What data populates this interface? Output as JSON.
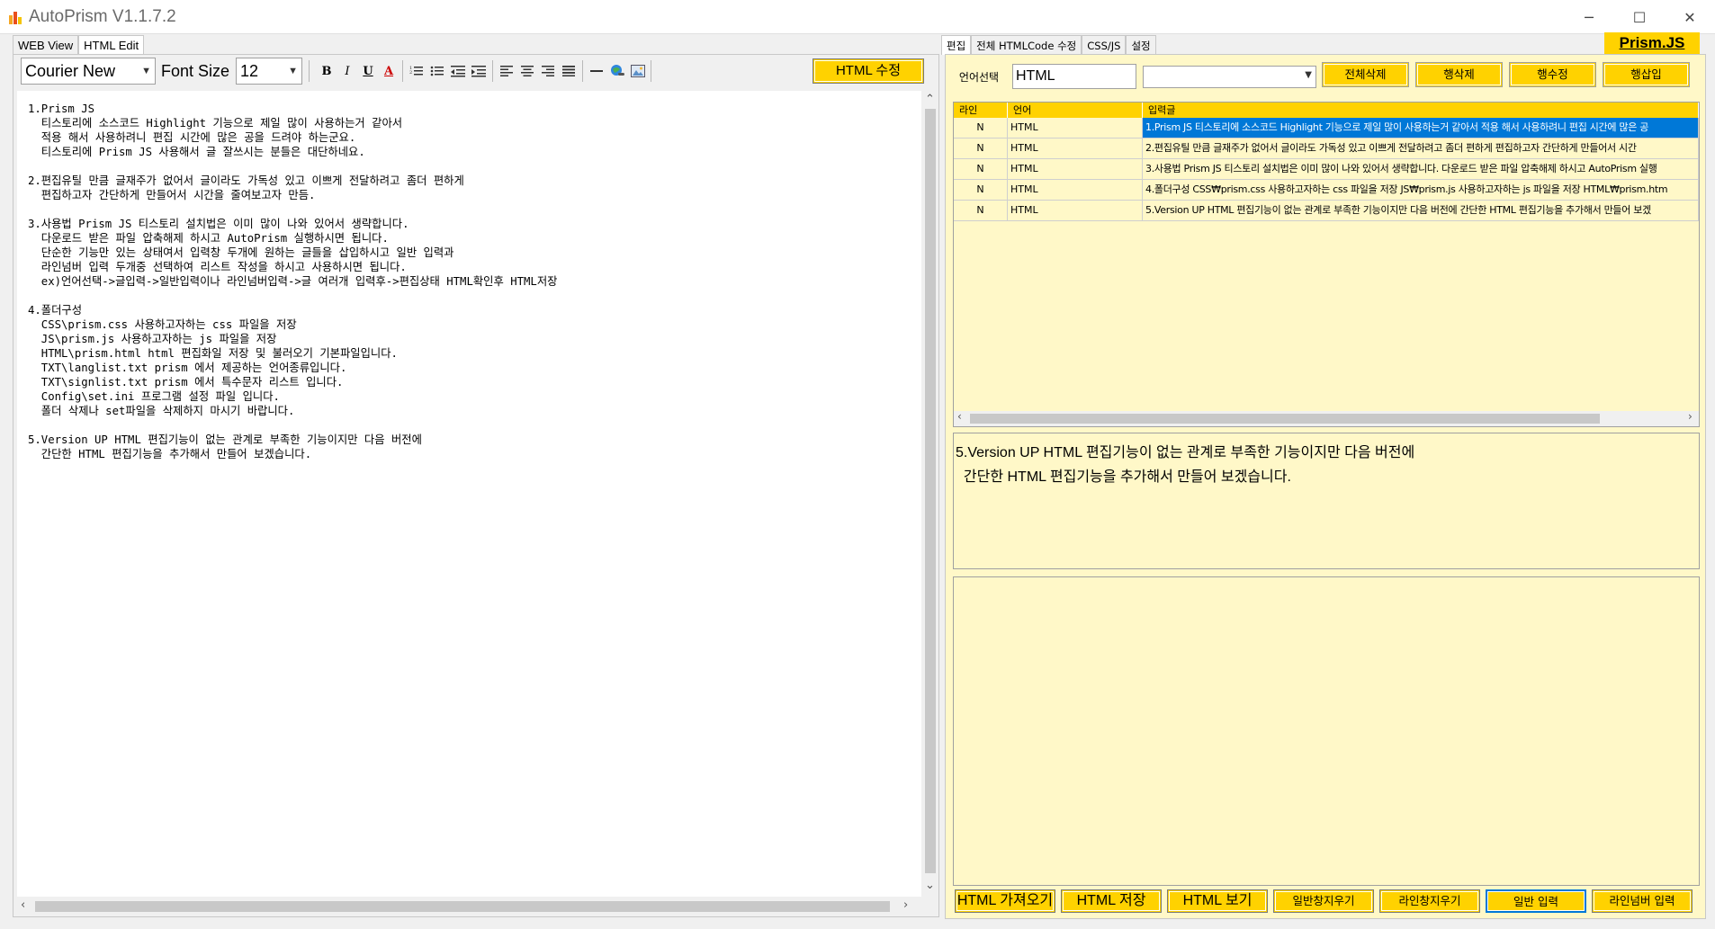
{
  "window": {
    "title": "AutoPrism V1.1.7.2",
    "minimize": "─",
    "maximize": "☐",
    "close": "✕"
  },
  "left": {
    "tabs": [
      "WEB View",
      "HTML Edit"
    ],
    "active_tab": "HTML Edit",
    "toolbar": {
      "font_name": "Courier New",
      "font_size_label": "Font Size",
      "font_size": "12",
      "bold": "B",
      "italic": "I",
      "underline": "U",
      "font_color": "A",
      "html_edit_button": "HTML 수정"
    },
    "editor_lines": [
      [
        "1.Prism JS",
        "  티스토리에 소스코드 Highlight 기능으로 제일 많이 사용하는거 같아서",
        "  적용 해서 사용하려니 편집 시간에 많은 공을 드려야 하는군요.",
        "  티스토리에 Prism JS 사용해서 글 잘쓰시는 분들은 대단하네요."
      ],
      [
        "2.편집유틸 만큼 글재주가 없어서 글이라도 가독성 있고 이쁘게 전달하려고 좀더 편하게",
        "  편집하고자 간단하게 만들어서 시간을 줄여보고자 만듬."
      ],
      [
        "3.사용법 Prism JS 티스토리 설치법은 이미 많이 나와 있어서 생략합니다.",
        "  다운로드 받은 파일 압축해제 하시고 AutoPrism 실행하시면 됩니다.",
        "  단순한 기능만 있는 상태여서 입력창 두개에 원하는 글들을 삽입하시고 일반 입력과",
        "  라인넘버 입력 두개중 선택하여 리스트 작성을 하시고 사용하시면 됩니다.",
        "  ex)언어선택->글입력->일반입력이나 라인넘버입력->글 여러개 입력후->편집상태 HTML확인후 HTML저장"
      ],
      [
        "4.폴더구성",
        "  CSS\\prism.css 사용하고자하는 css 파일을 저장",
        "  JS\\prism.js 사용하고자하는 js 파일을 저장",
        "  HTML\\prism.html html 편집화일 저장 및 불러오기 기본파일입니다.",
        "  TXT\\langlist.txt prism 에서 제공하는 언어종류입니다.",
        "  TXT\\signlist.txt prism 에서 특수문자 리스트 입니다.",
        "  Config\\set.ini 프로그램 설정 파일 입니다.",
        "  폴더 삭제나 set파일을 삭제하지 마시기 바랍니다."
      ],
      [
        "5.Version UP HTML 편집기능이 없는 관계로 부족한 기능이지만 다음 버전에",
        "  간단한 HTML 편집기능을 추가해서 만들어 보겠습니다."
      ]
    ]
  },
  "right": {
    "tabs": [
      "편집",
      "전체 HTMLCode 수정",
      "CSS/JS",
      "설정"
    ],
    "active_tab": "편집",
    "brand": "Prism.JS",
    "lang_label": "언어선택",
    "lang_value": "HTML",
    "lang_select_value": "",
    "top_buttons": [
      "전체삭제",
      "행삭제",
      "행수정",
      "행삽입"
    ],
    "grid": {
      "headers": [
        "라인",
        "언어",
        "입력글"
      ],
      "rows": [
        {
          "line": "N",
          "lang": "HTML",
          "text": "1.Prism JS   티스토리에 소스코드 Highlight 기능으로 제일 많이 사용하는거 같아서   적용 해서 사용하려니 편집 시간에 많은 공",
          "selected": true
        },
        {
          "line": "N",
          "lang": "HTML",
          "text": "2.편집유틸 만큼 글재주가 없어서 글이라도 가독성 있고 이쁘게 전달하려고 좀더 편하게   편집하고자 간단하게 만들어서 시간",
          "selected": false
        },
        {
          "line": "N",
          "lang": "HTML",
          "text": "3.사용법 Prism JS 티스토리 설치법은 이미 많이 나와 있어서 생략합니다.   다운로드 받은 파일 압축해제 하시고 AutoPrism 실행",
          "selected": false
        },
        {
          "line": "N",
          "lang": "HTML",
          "text": "4.폴더구성   CSS₩prism.css 사용하고자하는 css 파일을 저장   JS₩prism.js 사용하고자하는 js 파일을 저장   HTML₩prism.htm",
          "selected": false
        },
        {
          "line": "N",
          "lang": "HTML",
          "text": "5.Version UP HTML 편집기능이 없는 관계로 부족한 기능이지만 다음 버전에   간단한 HTML 편집기능을 추가해서 만들어 보겠",
          "selected": false
        }
      ]
    },
    "preview_text": "5.Version UP HTML 편집기능이 없는 관계로 부족한 기능이지만 다음 버전에\n  간단한 HTML 편집기능을 추가해서 만들어 보겠습니다.",
    "bottom_buttons": [
      "HTML 가져오기",
      "HTML 저장",
      "HTML 보기",
      "일반창지우기",
      "라인창지우기",
      "일반 입력",
      "라인넘버 입력"
    ]
  },
  "colors": {
    "accent": "#ffd200",
    "panel_bg": "#fff8c8",
    "selection": "#0078d7"
  }
}
